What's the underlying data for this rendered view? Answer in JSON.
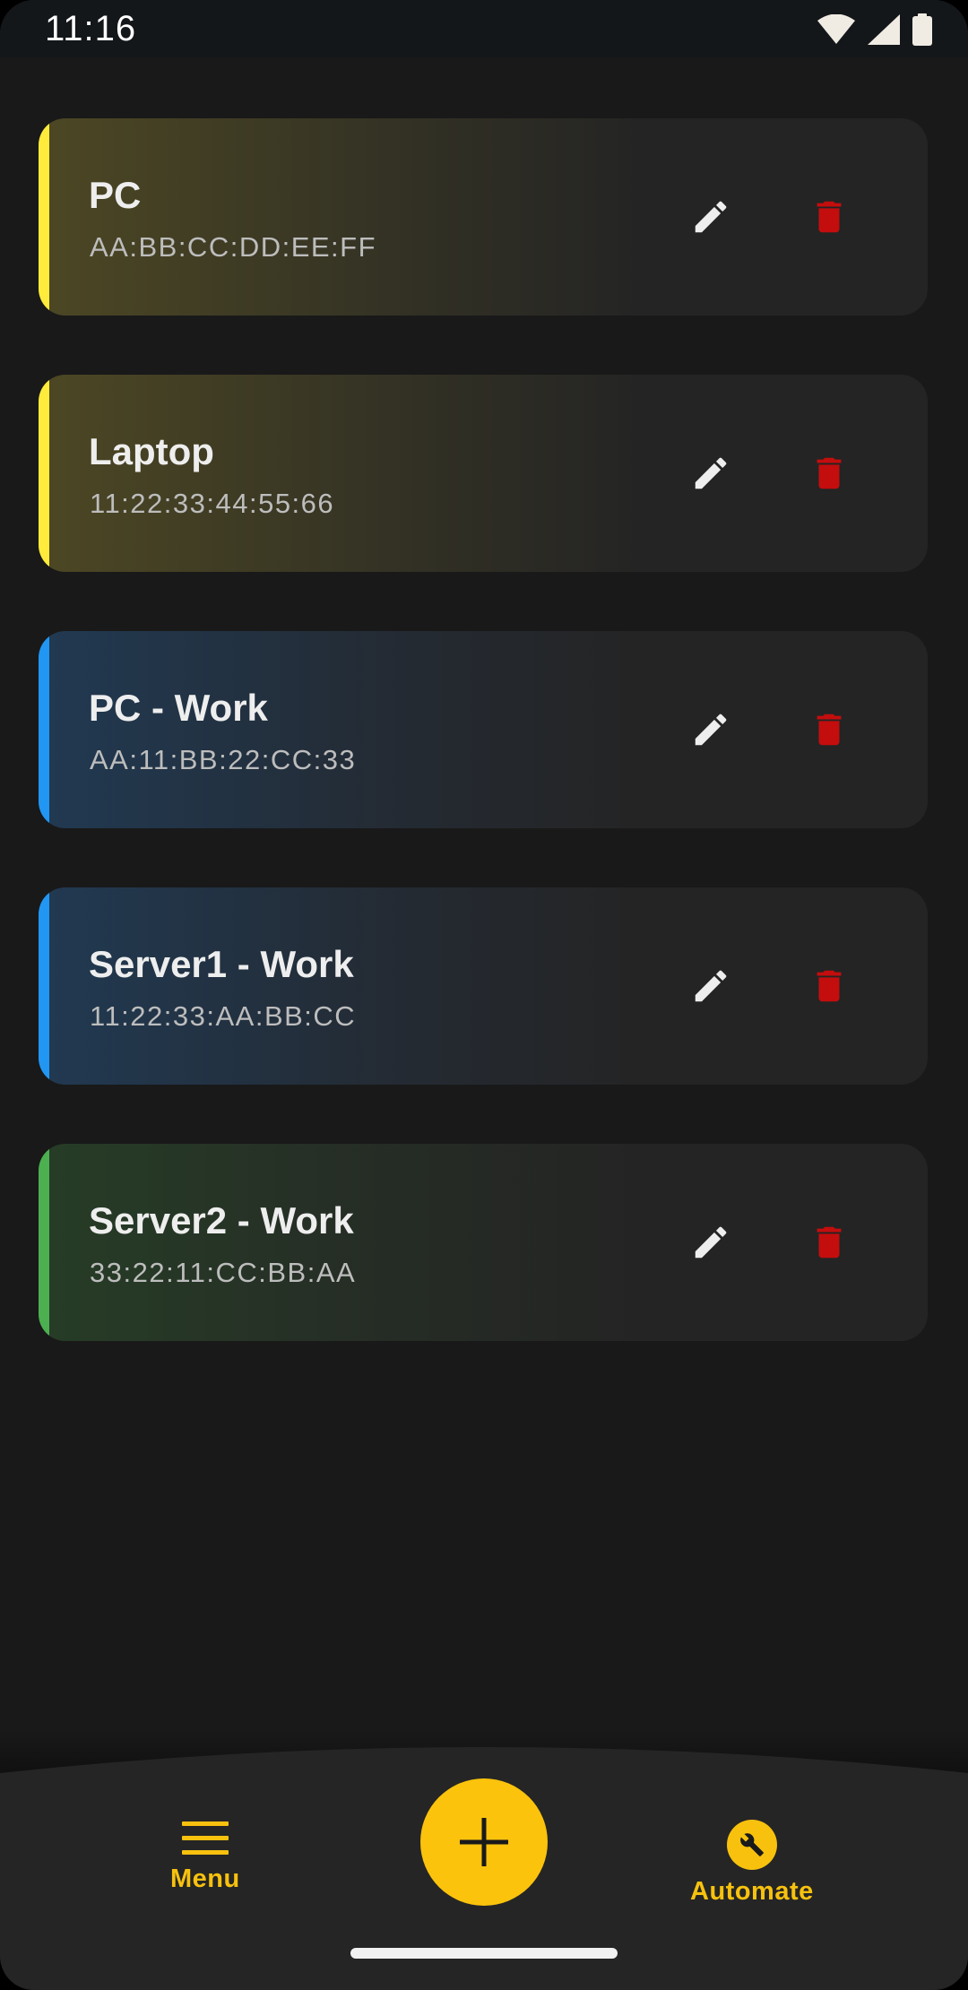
{
  "status_bar": {
    "time": "11:16"
  },
  "devices": [
    {
      "name": "PC",
      "mac": "AA:BB:CC:DD:EE:FF",
      "accent": "#ffeb3b",
      "glow": "rgba(120,110,40,0.45)"
    },
    {
      "name": "Laptop",
      "mac": "11:22:33:44:55:66",
      "accent": "#ffeb3b",
      "glow": "rgba(120,110,40,0.45)"
    },
    {
      "name": "PC - Work",
      "mac": "AA:11:BB:22:CC:33",
      "accent": "#2196f3",
      "glow": "rgba(30,80,130,0.45)"
    },
    {
      "name": "Server1 - Work",
      "mac": "11:22:33:AA:BB:CC",
      "accent": "#2196f3",
      "glow": "rgba(30,80,130,0.45)"
    },
    {
      "name": "Server2 - Work",
      "mac": "33:22:11:CC:BB:AA",
      "accent": "#4caf50",
      "glow": "rgba(40,90,40,0.40)"
    }
  ],
  "icons": {
    "edit": "pencil-icon",
    "delete": "trash-icon",
    "menu": "hamburger-menu-icon",
    "add": "plus-icon",
    "automate": "wrench-icon"
  },
  "colors": {
    "background": "#191919",
    "card": "#242424",
    "accent_primary": "#fcc30c",
    "delete": "#c40d0d",
    "edit": "#eeeeee"
  },
  "bottom_nav": {
    "menu_label": "Menu",
    "automate_label": "Automate"
  }
}
